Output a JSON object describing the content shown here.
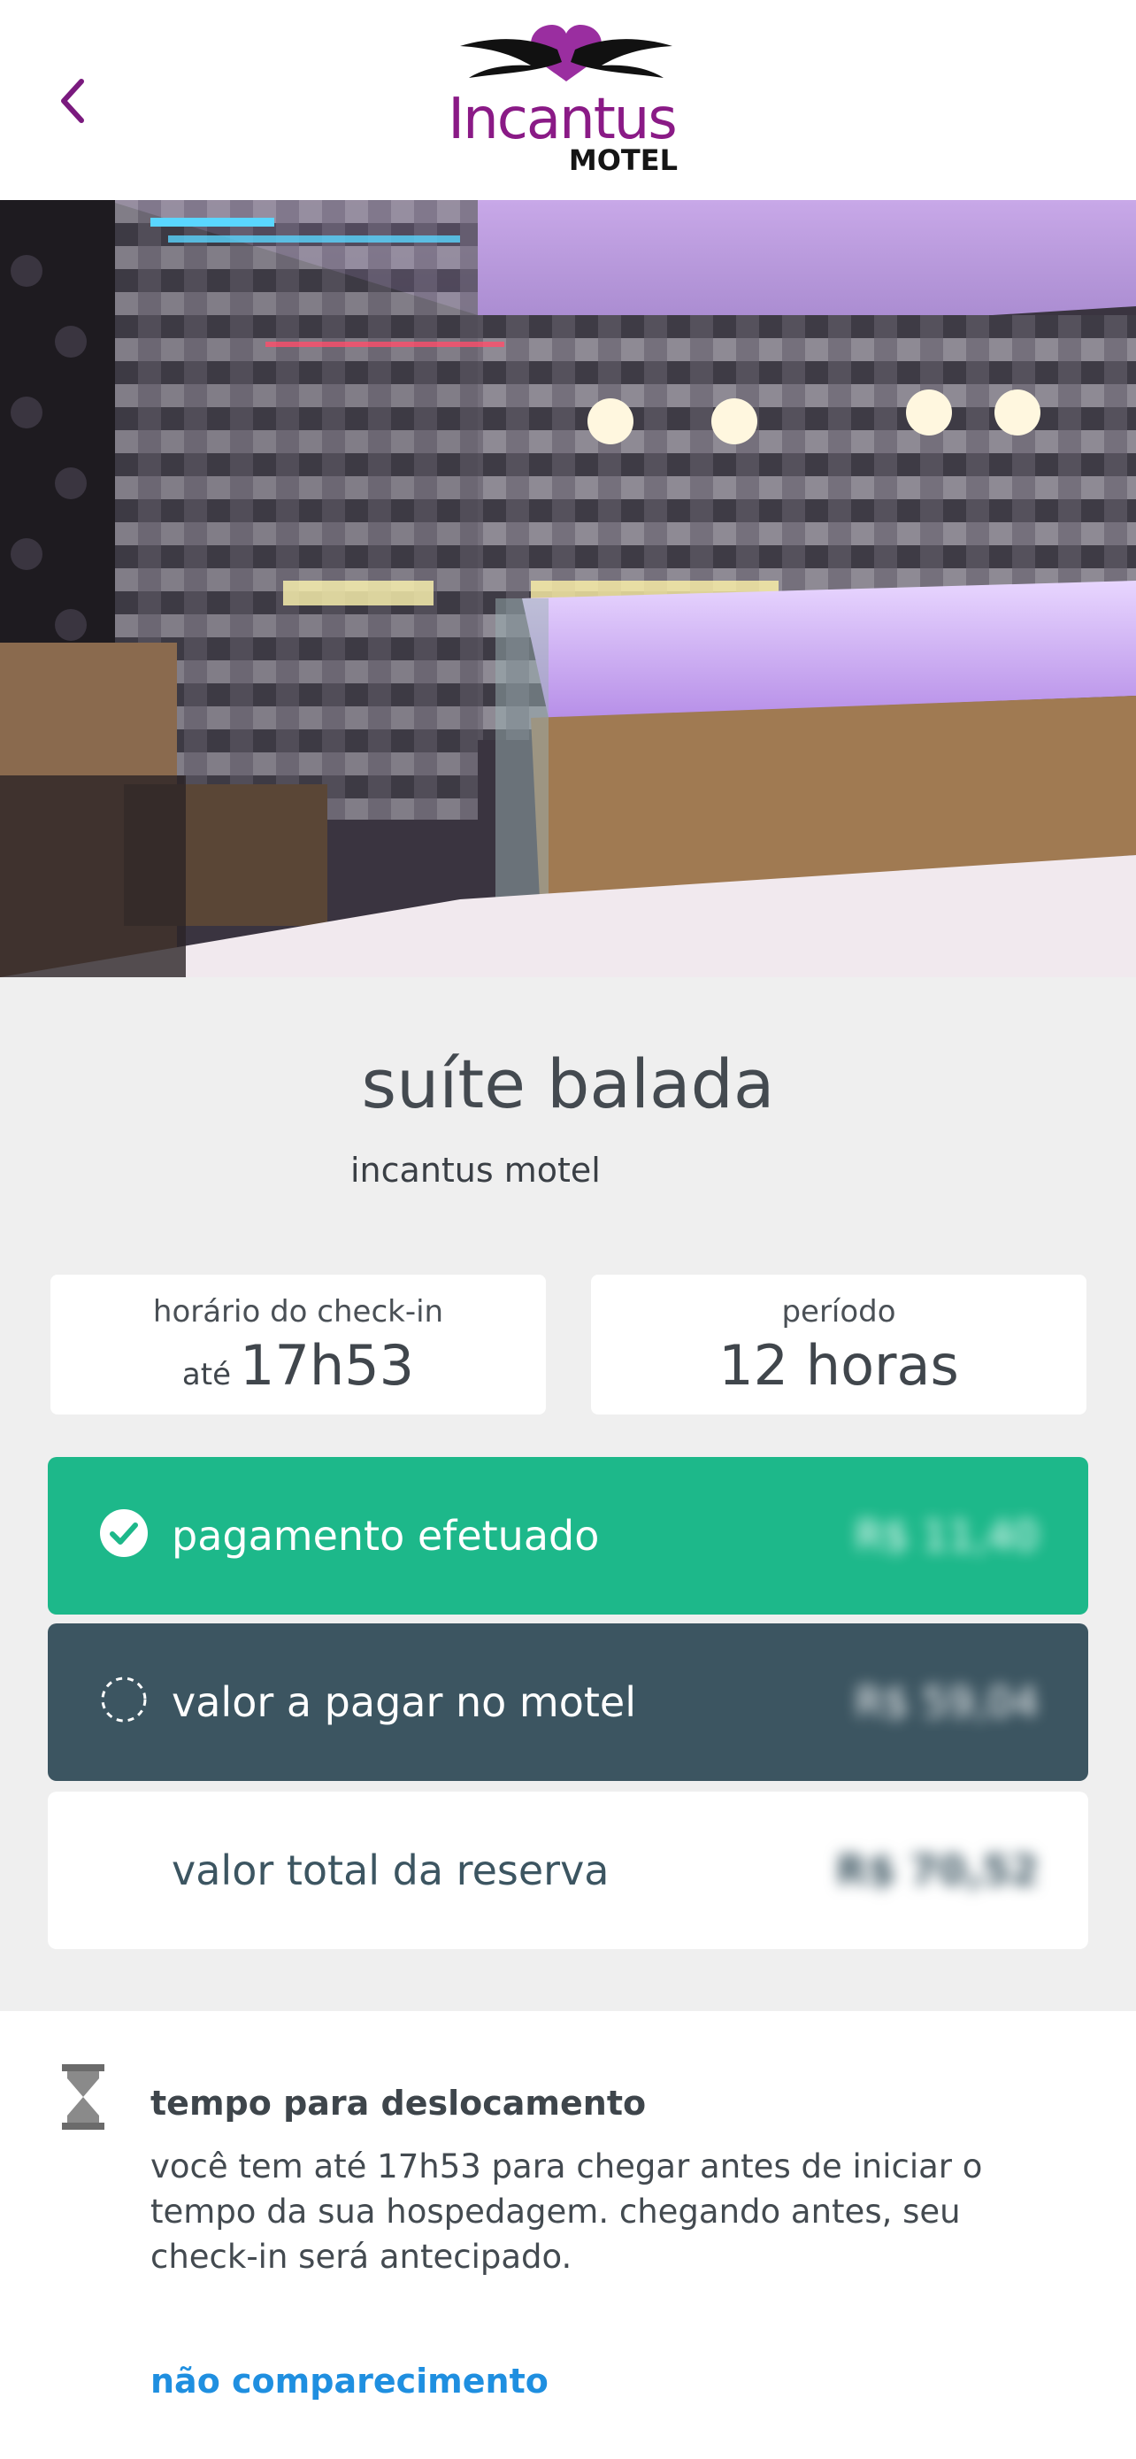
{
  "header": {
    "back_icon": "chevron-left-icon",
    "logo_text": "Incantus",
    "logo_sub": "MOTEL",
    "brand_color": "#8a1a86"
  },
  "suite": {
    "name": "suíte balada",
    "motel": "incantus motel"
  },
  "checkin": {
    "label": "horário do check-in",
    "prefix": "até",
    "time": "17h53"
  },
  "period": {
    "label": "período",
    "value": "12 horas"
  },
  "payment": {
    "paid_label": "pagamento efetuado",
    "paid_icon": "check-circle-icon",
    "paid_amount": "R$ 11,40",
    "due_label": "valor a pagar no motel",
    "due_icon": "dashed-circle-icon",
    "due_amount": "R$ 59,04",
    "total_label": "valor total da reserva",
    "total_amount": "R$ 70,52",
    "paid_color": "#1db88a",
    "due_color": "#3c5561"
  },
  "info": {
    "icon": "hourglass-icon",
    "title": "tempo para deslocamento",
    "body": "você tem até 17h53 para chegar antes de iniciar o tempo da sua hospedagem. chegando antes, seu check-in será antecipado.",
    "link": "não comparecimento",
    "link_color": "#1f8fe0"
  }
}
